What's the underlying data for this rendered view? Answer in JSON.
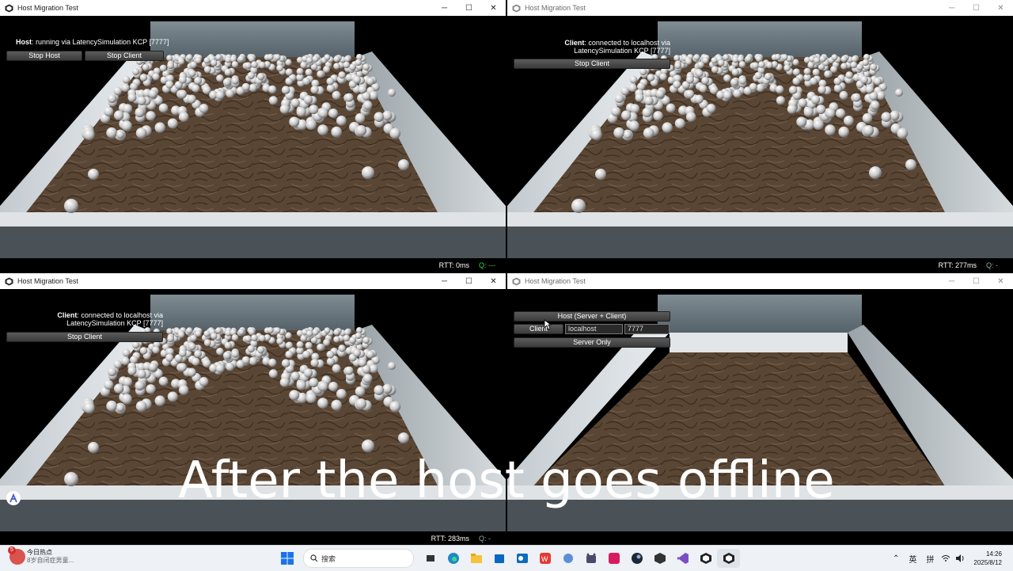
{
  "windows": [
    {
      "title": "Host Migration Test",
      "status_bold": "Host",
      "status_text": ": running via LatencySimulation KCP [7777]",
      "buttons": [
        "Stop Host",
        "Stop Client"
      ],
      "rtt": "RTT: 0ms",
      "q": "Q: ---"
    },
    {
      "title": "Host Migration Test",
      "status_bold": "Client",
      "status_line1": ": connected to localhost via",
      "status_line2": "LatencySimulation KCP [7777]",
      "buttons": [
        "Stop Client"
      ],
      "rtt": "RTT: 277ms",
      "q": "Q: -"
    },
    {
      "title": "Host Migration Test",
      "status_bold": "Client",
      "status_line1": ": connected to localhost via",
      "status_line2": "LatencySimulation KCP [7777]",
      "buttons": [
        "Stop Client"
      ],
      "rtt": "RTT: 283ms",
      "q": "Q: -"
    },
    {
      "title": "Host Migration Test",
      "host_button": "Host (Server + Client)",
      "client_button": "Client",
      "address_value": "localhost",
      "port_value": "7777",
      "server_only_button": "Server Only"
    }
  ],
  "window_controls": {
    "minimize": "─",
    "maximize": "☐",
    "close": "✕"
  },
  "caption": "After the host goes offline",
  "taskbar": {
    "news_badge": "5",
    "news_title": "今日热点",
    "news_sub": "8岁自闭症男童...",
    "search_placeholder": "搜索",
    "ime_lang": "英",
    "ime_mode": "拼",
    "time": "14:26",
    "date": "2025/8/12"
  },
  "colors": {
    "ground": "#5a4634",
    "wall": "#cfd5d9",
    "ball": "#e6e6e6",
    "q_green": "#3bd33b"
  }
}
